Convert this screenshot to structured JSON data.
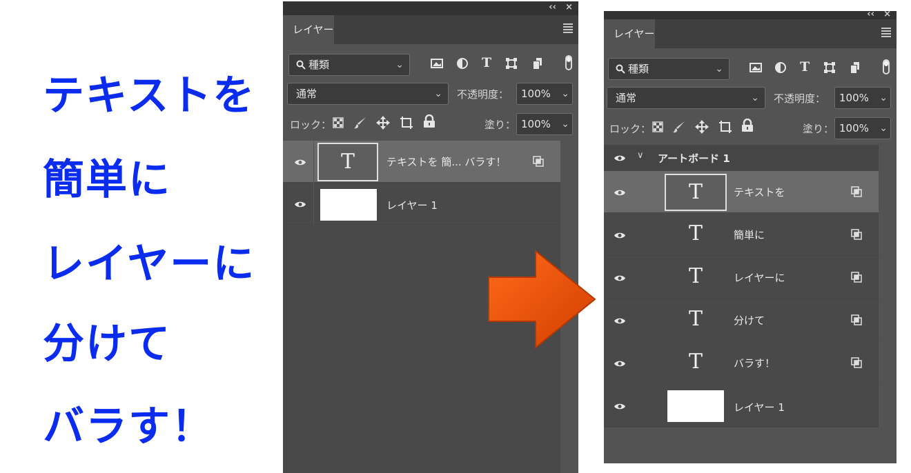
{
  "headline": [
    "テキストを",
    "簡単に",
    "レイヤーに",
    "分けて",
    "バラす！"
  ],
  "panel_before": {
    "tab": "レイヤー",
    "filter_value": "種類",
    "blend_mode": "通常",
    "opacity_label": "不透明度：",
    "opacity_value": "100%",
    "lock_label": "ロック：",
    "fill_label": "塗り：",
    "fill_value": "100%",
    "layers": [
      {
        "name": "テキストを 簡... バラす！",
        "type": "text",
        "selected": true
      },
      {
        "name": "レイヤー 1",
        "type": "pixel",
        "selected": false
      }
    ]
  },
  "panel_after": {
    "tab": "レイヤー",
    "filter_value": "種類",
    "blend_mode": "通常",
    "opacity_label": "不透明度：",
    "opacity_value": "100%",
    "lock_label": "ロック：",
    "fill_label": "塗り：",
    "fill_value": "100%",
    "artboard": "アートボード 1",
    "layers": [
      {
        "name": "テキストを",
        "type": "text",
        "selected": true
      },
      {
        "name": "簡単に",
        "type": "text",
        "selected": false
      },
      {
        "name": "レイヤーに",
        "type": "text",
        "selected": false
      },
      {
        "name": "分けて",
        "type": "text",
        "selected": false
      },
      {
        "name": "バラす！",
        "type": "text",
        "selected": false
      },
      {
        "name": "レイヤー 1",
        "type": "pixel",
        "selected": false
      }
    ]
  },
  "glyphs": {
    "text_thumb": "T",
    "collapse": "‹‹",
    "close": "×",
    "chevron": "⌄",
    "disclosure": "∨"
  },
  "colors": {
    "headline": "#0a2bf0",
    "arrow": "#e8500a",
    "panel": "#535353",
    "selected_row": "#6b6b6b"
  }
}
